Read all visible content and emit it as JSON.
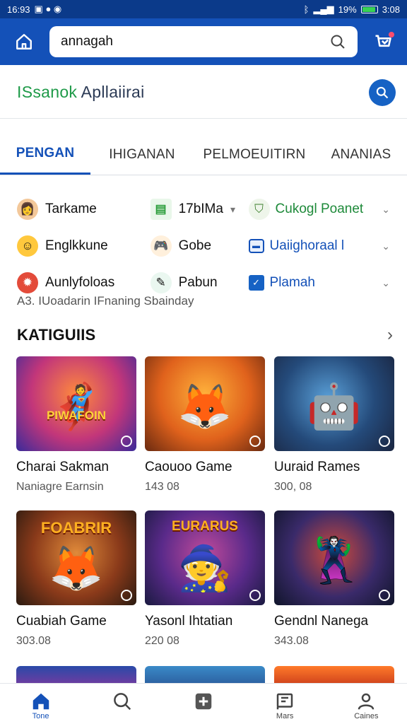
{
  "status": {
    "time_left": "16:93",
    "signal": "19%",
    "time_right": "3:08"
  },
  "header": {
    "search_value": "annagah"
  },
  "title": {
    "part1": "ISsanok",
    "part2": " Apllaiirai"
  },
  "tabs": [
    {
      "label": "PENGAN",
      "active": true
    },
    {
      "label": "IHIGANAN",
      "active": false
    },
    {
      "label": "PELMOEUITIRN",
      "active": false
    },
    {
      "label": "ANANIAS",
      "active": false
    }
  ],
  "filters": {
    "row1": {
      "a": "Tarkame",
      "b": "17bIMa",
      "c": "Cukogl Poanet"
    },
    "row2": {
      "a": "Englkkune",
      "b": "Gobe",
      "c": "Uaiighoraal l"
    },
    "row3": {
      "a": "Aunlyfoloas",
      "b": "Pabun",
      "c": "Plamah"
    },
    "subline": "A3.  IUoadarin IFnaning Sbainday"
  },
  "section": {
    "title": "KATIGUIIS"
  },
  "cards": [
    {
      "name": "Charai Sakman",
      "sub": "Naniagre Earnsin",
      "banner": "PIWAFOIN"
    },
    {
      "name": "Caouoo Game",
      "sub": "143 08",
      "banner": ""
    },
    {
      "name": "Uuraid Rames",
      "sub": "300, 08",
      "banner": ""
    },
    {
      "name": "Cuabiah Game",
      "sub": "303.08",
      "banner": "FOABRIR"
    },
    {
      "name": "Yasonl Ihtatian",
      "sub": "220 08",
      "banner": "EURARUS"
    },
    {
      "name": "Gendnl Nanega",
      "sub": "343.08",
      "banner": ""
    }
  ],
  "nav": [
    {
      "label": "Tone",
      "active": true
    },
    {
      "label": "",
      "active": false
    },
    {
      "label": "",
      "active": false
    },
    {
      "label": "Mars",
      "active": false
    },
    {
      "label": "Caines",
      "active": false
    }
  ]
}
